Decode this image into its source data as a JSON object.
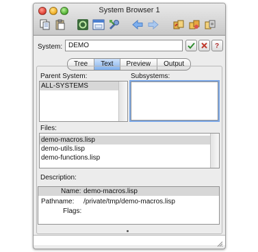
{
  "window": {
    "title": "System Browser 1"
  },
  "toolbar": {
    "icons": [
      "copy-doc-icon",
      "paste-doc-icon",
      "refresh-icon",
      "window-icon",
      "tools-icon",
      "back-arrow-icon",
      "forward-arrow-icon",
      "compile-icon",
      "load-icon",
      "package-icon"
    ]
  },
  "system": {
    "label": "System:",
    "value": "DEMO"
  },
  "tabs": [
    {
      "label": "Tree"
    },
    {
      "label": "Text"
    },
    {
      "label": "Preview"
    },
    {
      "label": "Output"
    }
  ],
  "parent_system": {
    "label": "Parent System:",
    "items": [
      "ALL-SYSTEMS"
    ]
  },
  "subsystems": {
    "label": "Subsystems:",
    "items": []
  },
  "files": {
    "label": "Files:",
    "items": [
      "demo-macros.lisp",
      "demo-utils.lisp",
      "demo-functions.lisp"
    ]
  },
  "description": {
    "label": "Description:",
    "name_label": "Name:",
    "name_value": "demo-macros.lisp",
    "pathname_label": "Pathname:",
    "pathname_value": "/private/tmp/demo-macros.lisp",
    "flags_label": "Flags:",
    "flags_value": ""
  },
  "colors": {
    "accent": "#7fb0ee",
    "selection": "#d7d7d7"
  }
}
